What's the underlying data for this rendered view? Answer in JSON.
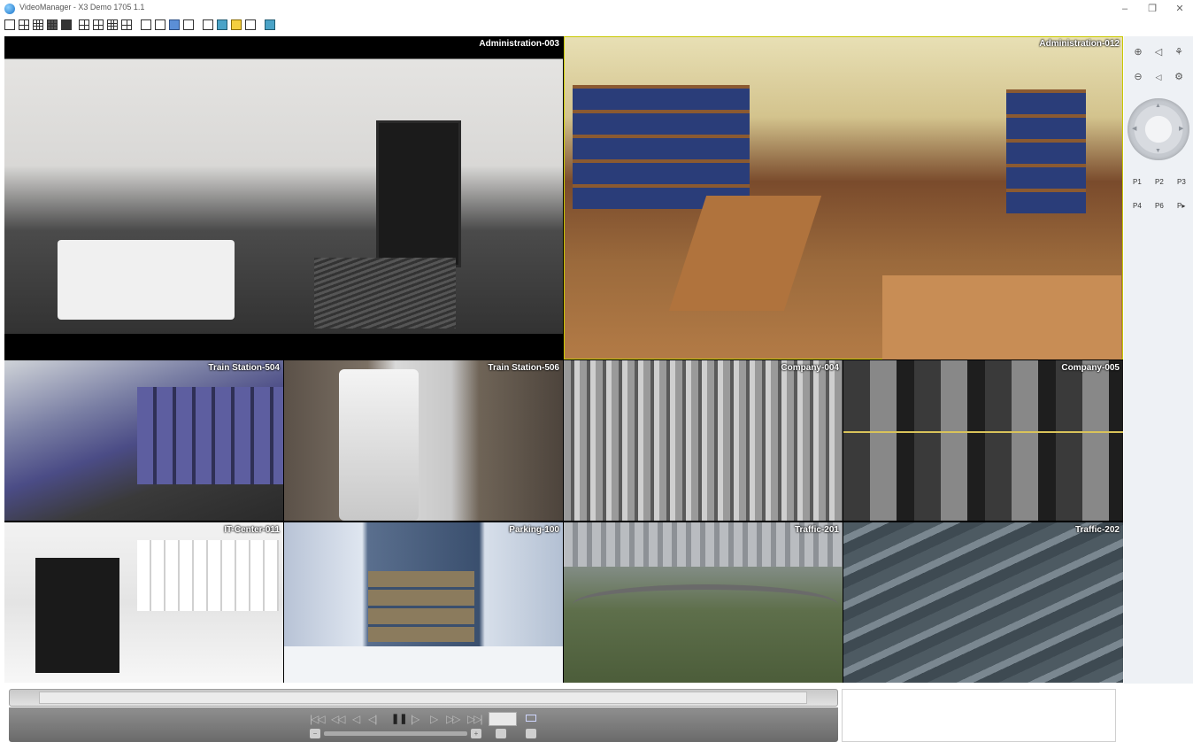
{
  "window": {
    "title": "VideoManager - X3 Demo 1705 1.1",
    "icon": "app-icon",
    "minimize_glyph": "–",
    "restore_glyph": "❐",
    "close_glyph": "✕"
  },
  "toolbar": {
    "buttons": [
      {
        "name": "layout-1x1-button"
      },
      {
        "name": "layout-2x2-button"
      },
      {
        "name": "layout-3x3-button"
      },
      {
        "name": "layout-4x4-button"
      },
      {
        "name": "layout-5x5-button"
      },
      {
        "name": "layout-1plus5-button"
      },
      {
        "name": "layout-1plus7-button"
      },
      {
        "name": "layout-2plus8-button"
      },
      {
        "name": "layout-1plus12-button"
      },
      {
        "name": "zoom-window-button"
      },
      {
        "name": "digital-zoom-button"
      },
      {
        "name": "ptz-toggle-button"
      },
      {
        "name": "sequence-button"
      },
      {
        "name": "fullscreen-button"
      },
      {
        "name": "panel-blue-button"
      },
      {
        "name": "panel-yellow-button"
      },
      {
        "name": "panel-timeline-button"
      },
      {
        "name": "snapshot-button"
      }
    ]
  },
  "cameras": [
    {
      "label": "Administration-003",
      "scene": "lobby"
    },
    {
      "label": "Administration-012",
      "scene": "office",
      "selected": true
    },
    {
      "label": "Train Station-504",
      "scene": "train"
    },
    {
      "label": "Train Station-506",
      "scene": "tracks"
    },
    {
      "label": "Company-004",
      "scene": "parking-lot"
    },
    {
      "label": "Company-005",
      "scene": "parking-gray"
    },
    {
      "label": "IT-Center-011",
      "scene": "datacenter"
    },
    {
      "label": "Parking-100",
      "scene": "garage"
    },
    {
      "label": "Traffic-201",
      "scene": "traffic1"
    },
    {
      "label": "Traffic-202",
      "scene": "traffic2"
    }
  ],
  "ptz": {
    "zoom_in_glyph": "⊕",
    "zoom_out_glyph": "⊖",
    "focus_near_glyph": "◁",
    "focus_far_glyph": "◁",
    "iris_open_glyph": "⚘",
    "iris_close_glyph": "⚙",
    "joystick_arrows": {
      "up": "▲",
      "down": "▼",
      "left": "◀",
      "right": "▶"
    },
    "presets": [
      "P1",
      "P2",
      "P3",
      "P4",
      "P6",
      "P▸"
    ]
  },
  "playback": {
    "skip_start": "|◁◁",
    "fast_rewind": "◁◁",
    "step_back": "◁",
    "frame_back": "◁|",
    "pause": "❚❚",
    "frame_forward": "|▷",
    "step_forward": "▷",
    "fast_forward": "▷▷",
    "skip_end": "▷▷|",
    "slider_minus": "−",
    "slider_plus": "+"
  }
}
